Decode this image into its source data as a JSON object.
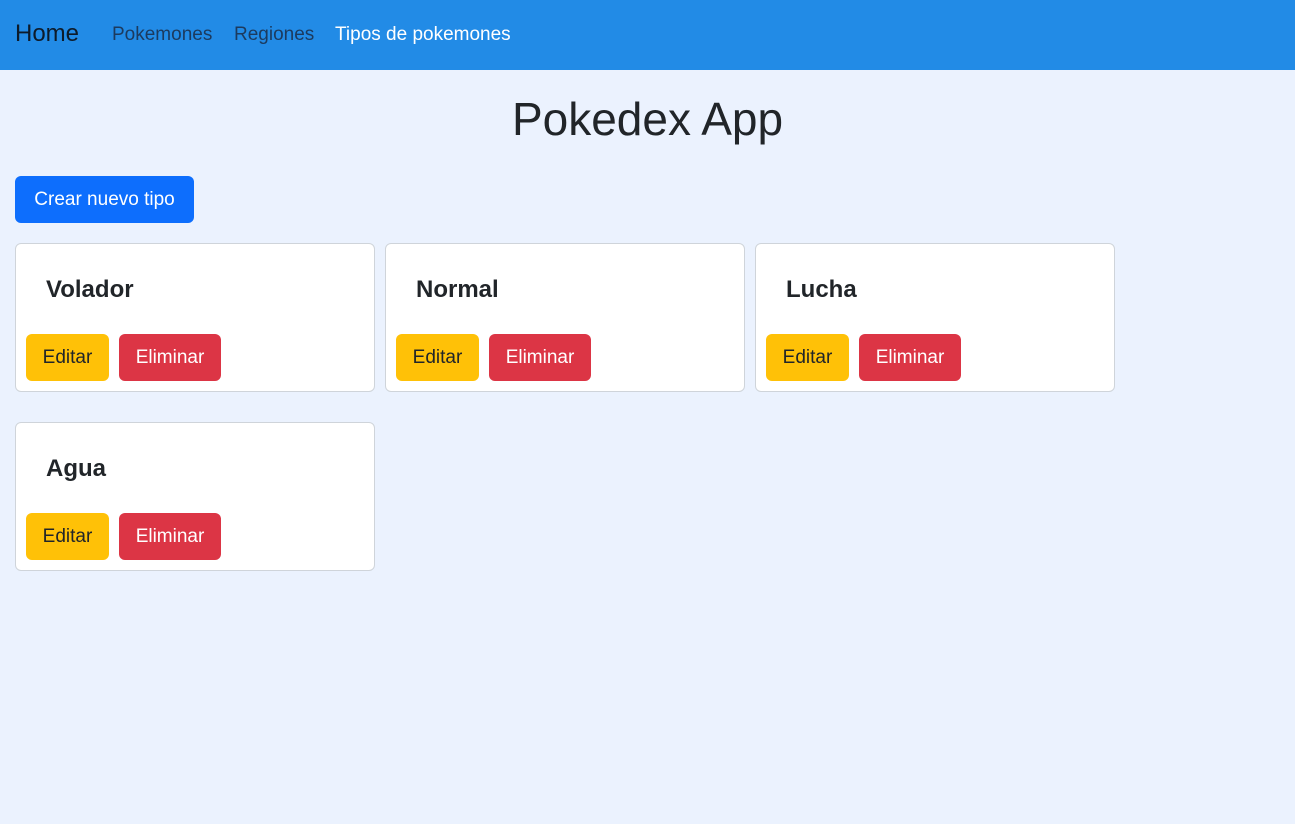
{
  "navbar": {
    "brand": "Home",
    "links": [
      {
        "label": "Pokemones",
        "active": false
      },
      {
        "label": "Regiones",
        "active": false
      },
      {
        "label": "Tipos de pokemones",
        "active": true
      }
    ]
  },
  "main": {
    "title": "Pokedex App",
    "create_button": "Crear nuevo tipo",
    "types": [
      {
        "name": "Volador",
        "edit_label": "Editar",
        "delete_label": "Eliminar"
      },
      {
        "name": "Normal",
        "edit_label": "Editar",
        "delete_label": "Eliminar"
      },
      {
        "name": "Lucha",
        "edit_label": "Editar",
        "delete_label": "Eliminar"
      },
      {
        "name": "Agua",
        "edit_label": "Editar",
        "delete_label": "Eliminar"
      }
    ]
  },
  "colors": {
    "navbar": "#228be6",
    "background": "#ebf2fe",
    "primary": "#0d6efd",
    "warning": "#ffc107",
    "danger": "#dc3545"
  }
}
